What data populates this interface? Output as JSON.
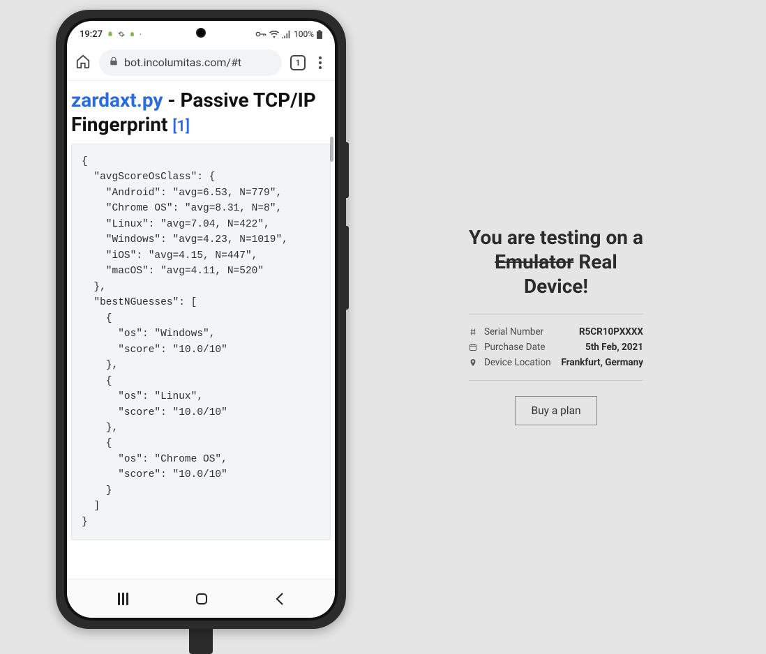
{
  "status": {
    "time": "19:27",
    "battery": "100%"
  },
  "browser": {
    "url": "bot.incolumitas.com/#t",
    "tab_count": "1"
  },
  "page": {
    "title_link": "zardaxt.py",
    "title_rest": " - Passive TCP/IP Fingerprint ",
    "title_ref": "[1]",
    "code": "{\n  \"avgScoreOsClass\": {\n    \"Android\": \"avg=6.53, N=779\",\n    \"Chrome OS\": \"avg=8.31, N=8\",\n    \"Linux\": \"avg=7.04, N=422\",\n    \"Windows\": \"avg=4.23, N=1019\",\n    \"iOS\": \"avg=4.15, N=447\",\n    \"macOS\": \"avg=4.11, N=520\"\n  },\n  \"bestNGuesses\": [\n    {\n      \"os\": \"Windows\",\n      \"score\": \"10.0/10\"\n    },\n    {\n      \"os\": \"Linux\",\n      \"score\": \"10.0/10\"\n    },\n    {\n      \"os\": \"Chrome OS\",\n      \"score\": \"10.0/10\"\n    }\n  ]\n}"
  },
  "info": {
    "heading_pre": "You are testing on a ",
    "heading_strike": "Emulator",
    "heading_post": " Real Device!",
    "serial_label": "Serial Number",
    "serial_value": "R5CR10PXXXX",
    "purchase_label": "Purchase Date",
    "purchase_value": "5th Feb, 2021",
    "location_label": "Device Location",
    "location_value": "Frankfurt, Germany",
    "buy_label": "Buy a plan"
  }
}
